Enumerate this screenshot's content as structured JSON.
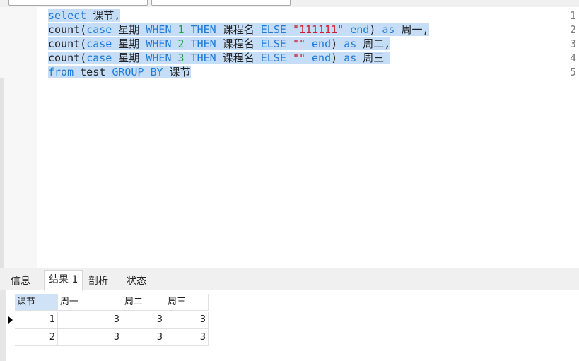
{
  "editor": {
    "line_numbers": [
      "1",
      "2",
      "3",
      "4",
      "5"
    ],
    "lines": [
      [
        {
          "t": "select",
          "c": "kw"
        },
        {
          "t": " 课节,",
          "c": ""
        }
      ],
      [
        {
          "t": "count(",
          "c": ""
        },
        {
          "t": "case",
          "c": "kw"
        },
        {
          "t": " 星期 ",
          "c": ""
        },
        {
          "t": "WHEN",
          "c": "kw"
        },
        {
          "t": " ",
          "c": ""
        },
        {
          "t": "1",
          "c": "num"
        },
        {
          "t": " ",
          "c": ""
        },
        {
          "t": "THEN",
          "c": "kw"
        },
        {
          "t": " 课程名 ",
          "c": ""
        },
        {
          "t": "ELSE",
          "c": "kw"
        },
        {
          "t": " ",
          "c": ""
        },
        {
          "t": "\"111111\"",
          "c": "str"
        },
        {
          "t": " ",
          "c": ""
        },
        {
          "t": "end",
          "c": "kw"
        },
        {
          "t": ") ",
          "c": ""
        },
        {
          "t": "as",
          "c": "kw"
        },
        {
          "t": " 周一,",
          "c": ""
        }
      ],
      [
        {
          "t": "count(",
          "c": ""
        },
        {
          "t": "case",
          "c": "kw"
        },
        {
          "t": " 星期 ",
          "c": ""
        },
        {
          "t": "WHEN",
          "c": "kw"
        },
        {
          "t": " ",
          "c": ""
        },
        {
          "t": "2",
          "c": "num"
        },
        {
          "t": " ",
          "c": ""
        },
        {
          "t": "THEN",
          "c": "kw"
        },
        {
          "t": " 课程名 ",
          "c": ""
        },
        {
          "t": "ELSE",
          "c": "kw"
        },
        {
          "t": " ",
          "c": ""
        },
        {
          "t": "\"\"",
          "c": "str"
        },
        {
          "t": " ",
          "c": ""
        },
        {
          "t": "end",
          "c": "kw"
        },
        {
          "t": ") ",
          "c": ""
        },
        {
          "t": "as",
          "c": "kw"
        },
        {
          "t": " 周二,",
          "c": ""
        }
      ],
      [
        {
          "t": "count(",
          "c": ""
        },
        {
          "t": "case",
          "c": "kw"
        },
        {
          "t": " 星期 ",
          "c": ""
        },
        {
          "t": "WHEN",
          "c": "kw"
        },
        {
          "t": " ",
          "c": ""
        },
        {
          "t": "3",
          "c": "num"
        },
        {
          "t": " ",
          "c": ""
        },
        {
          "t": "THEN",
          "c": "kw"
        },
        {
          "t": " 课程名 ",
          "c": ""
        },
        {
          "t": "ELSE",
          "c": "kw"
        },
        {
          "t": " ",
          "c": ""
        },
        {
          "t": "\"\"",
          "c": "str"
        },
        {
          "t": " ",
          "c": ""
        },
        {
          "t": "end",
          "c": "kw"
        },
        {
          "t": ") ",
          "c": ""
        },
        {
          "t": "as",
          "c": "kw"
        },
        {
          "t": " 周三 ",
          "c": ""
        }
      ],
      [
        {
          "t": "from",
          "c": "kw"
        },
        {
          "t": " test ",
          "c": ""
        },
        {
          "t": "GROUP BY",
          "c": "kw"
        },
        {
          "t": " 课节",
          "c": ""
        }
      ]
    ]
  },
  "tabs": [
    {
      "label": "信息",
      "active": false
    },
    {
      "label": "结果 1",
      "active": true
    },
    {
      "label": "剖析",
      "active": false
    },
    {
      "label": "状态",
      "active": false
    }
  ],
  "grid": {
    "columns": [
      "课节",
      "周一",
      "周二",
      "周三"
    ],
    "rows": [
      [
        "1",
        "3",
        "3",
        "3"
      ],
      [
        "2",
        "3",
        "3",
        "3"
      ]
    ]
  },
  "colors": {
    "keyword": "#1d7ad6",
    "number": "#18a33b",
    "string": "#d21b2b",
    "selection": "#c5ddf7"
  }
}
